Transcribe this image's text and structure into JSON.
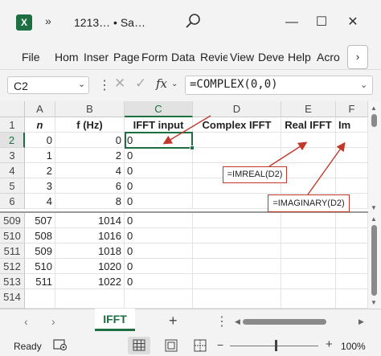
{
  "window": {
    "app_icon_letter": "X",
    "more_label": "»",
    "title": "1213… • Sa…",
    "minimize": "—",
    "maximize": "☐",
    "close": "✕"
  },
  "ribbon": {
    "tabs": [
      "File",
      "Hom",
      "Inser",
      "Page",
      "Form",
      "Data",
      "Revie",
      "View",
      "Deve",
      "Help",
      "Acro"
    ],
    "more": "›"
  },
  "formula_bar": {
    "name_box": "C2",
    "name_arrow": "⌄",
    "dots": "⋮",
    "cancel": "✕",
    "enter": "✓",
    "fx": "fx",
    "fx_arrow": "⌄",
    "formula": "=COMPLEX(0,0)",
    "formula_arrow": "⌄"
  },
  "grid": {
    "columns": [
      "A",
      "B",
      "C",
      "D",
      "E",
      "F"
    ],
    "header_row": {
      "row": "1",
      "a": "n",
      "b": "f (Hz)",
      "c": "IFFT input",
      "d": "Complex IFFT",
      "e": "Real IFFT",
      "f": "Im"
    },
    "top_rows": [
      {
        "row": "2",
        "a": "0",
        "b": "0",
        "c": "0"
      },
      {
        "row": "3",
        "a": "1",
        "b": "2",
        "c": "0"
      },
      {
        "row": "4",
        "a": "2",
        "b": "4",
        "c": "0"
      },
      {
        "row": "5",
        "a": "3",
        "b": "6",
        "c": "0"
      },
      {
        "row": "6",
        "a": "4",
        "b": "8",
        "c": "0"
      }
    ],
    "bottom_rows": [
      {
        "row": "509",
        "a": "507",
        "b": "1014",
        "c": "0"
      },
      {
        "row": "510",
        "a": "508",
        "b": "1016",
        "c": "0"
      },
      {
        "row": "511",
        "a": "509",
        "b": "1018",
        "c": "0"
      },
      {
        "row": "512",
        "a": "510",
        "b": "1020",
        "c": "0"
      },
      {
        "row": "513",
        "a": "511",
        "b": "1022",
        "c": "0"
      },
      {
        "row": "514",
        "a": "",
        "b": "",
        "c": ""
      }
    ]
  },
  "callouts": {
    "imreal": "=IMREAL(D2)",
    "imaginary": "=IMAGINARY(D2)",
    "color": "#c0392b"
  },
  "sheets": {
    "prev": "‹",
    "next": "›",
    "active": "IFFT",
    "add": "+",
    "dots": "⋮",
    "left": "◀",
    "right": "▶"
  },
  "status": {
    "ready": "Ready",
    "zoom_minus": "−",
    "zoom_plus": "+",
    "zoom_level": "100%"
  },
  "colors": {
    "accent": "#1d6f42"
  }
}
